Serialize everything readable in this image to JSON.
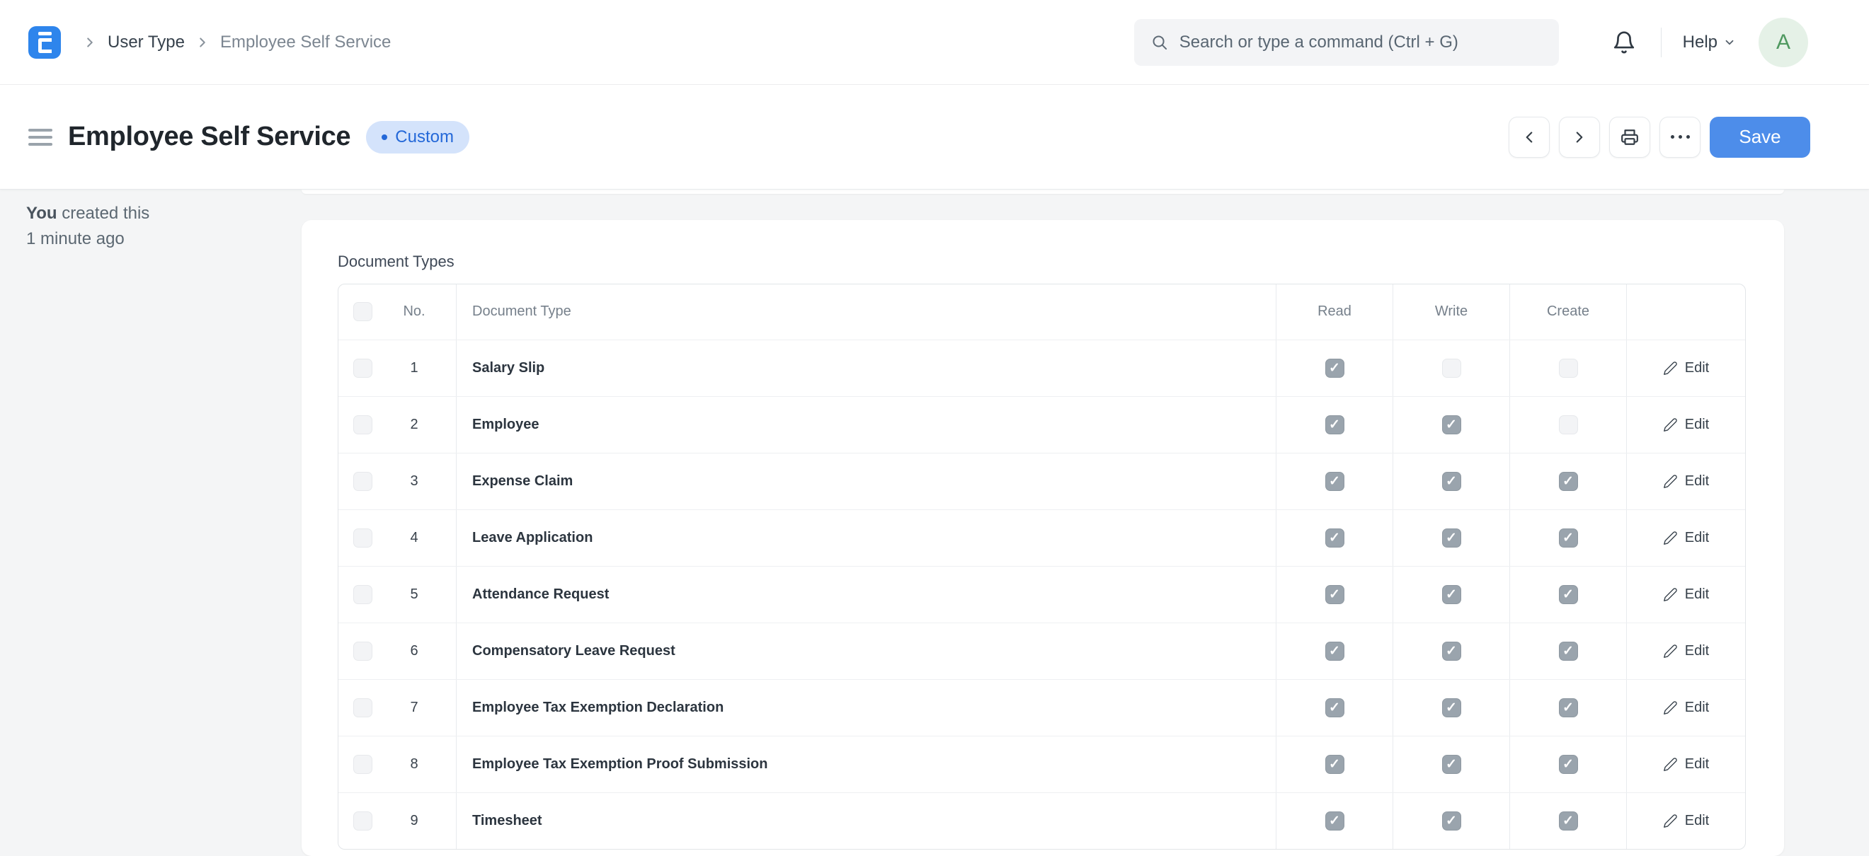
{
  "navbar": {
    "breadcrumb": {
      "level1": "User Type",
      "level2": "Employee Self Service"
    },
    "search_placeholder": "Search or type a command (Ctrl + G)",
    "help_label": "Help",
    "avatar_letter": "A"
  },
  "page_head": {
    "title": "Employee Self Service",
    "status_badge": "Custom",
    "save_label": "Save"
  },
  "sidebar": {
    "created_by": "You",
    "created_action": "created this",
    "created_time": "1 minute ago"
  },
  "document_types": {
    "section_title": "Document Types",
    "columns": {
      "no": "No.",
      "document_type": "Document Type",
      "read": "Read",
      "write": "Write",
      "create": "Create"
    },
    "edit_label": "Edit",
    "rows": [
      {
        "no": "1",
        "document_type": "Salary Slip",
        "read": true,
        "write": false,
        "create": false
      },
      {
        "no": "2",
        "document_type": "Employee",
        "read": true,
        "write": true,
        "create": false
      },
      {
        "no": "3",
        "document_type": "Expense Claim",
        "read": true,
        "write": true,
        "create": true
      },
      {
        "no": "4",
        "document_type": "Leave Application",
        "read": true,
        "write": true,
        "create": true
      },
      {
        "no": "5",
        "document_type": "Attendance Request",
        "read": true,
        "write": true,
        "create": true
      },
      {
        "no": "6",
        "document_type": "Compensatory Leave Request",
        "read": true,
        "write": true,
        "create": true
      },
      {
        "no": "7",
        "document_type": "Employee Tax Exemption Declaration",
        "read": true,
        "write": true,
        "create": true
      },
      {
        "no": "8",
        "document_type": "Employee Tax Exemption Proof Submission",
        "read": true,
        "write": true,
        "create": true
      },
      {
        "no": "9",
        "document_type": "Timesheet",
        "read": true,
        "write": true,
        "create": true
      }
    ]
  },
  "icons": [
    "erpnext-logo",
    "chevron-right-icon",
    "search-icon",
    "bell-icon",
    "chevron-down-icon",
    "menu-icon",
    "chevron-left-icon",
    "printer-icon",
    "ellipsis-icon",
    "edit-pencil-icon"
  ],
  "colors": {
    "accent_blue": "#4d8dea",
    "brand_blue": "#2e85ec",
    "badge_bg": "#d4e3fb",
    "badge_text": "#2468d8",
    "avatar_bg": "#e5f1e7",
    "avatar_text": "#4f9960",
    "checkbox_checked": "#9aa4ad",
    "page_bg": "#f4f5f6"
  }
}
